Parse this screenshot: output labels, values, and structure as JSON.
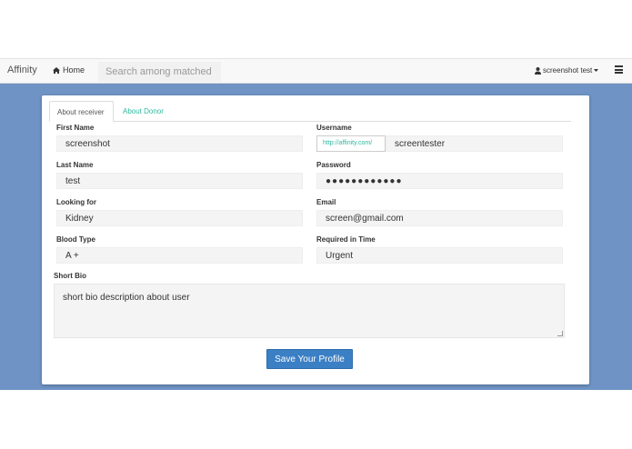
{
  "nav": {
    "brand": "Affinity",
    "home_label": "Home",
    "search_placeholder": "Search among matched",
    "user_label": "screenshot test"
  },
  "tabs": [
    {
      "label": "About receiver",
      "active": true
    },
    {
      "label": "About Donor",
      "active": false
    }
  ],
  "form": {
    "first_name": {
      "label": "First Name",
      "value": "screenshot"
    },
    "username": {
      "label": "Username",
      "prefix": "http://affinity.com/",
      "value": "screentester"
    },
    "last_name": {
      "label": "Last Name",
      "value": "test"
    },
    "password": {
      "label": "Password",
      "value": "●●●●●●●●●●●●"
    },
    "looking_for": {
      "label": "Looking for",
      "value": "Kidney"
    },
    "email": {
      "label": "Email",
      "value": "screen@gmail.com"
    },
    "blood_type": {
      "label": "Blood Type",
      "value": "A +"
    },
    "required_in_time": {
      "label": "Required in Time",
      "value": "Urgent"
    },
    "short_bio": {
      "label": "Short Bio",
      "value": "short bio description about user"
    }
  },
  "save_label": "Save Your Profile",
  "colors": {
    "background": "#6e93c4",
    "accent": "#2fb8a0",
    "button": "#3b7fc4"
  }
}
